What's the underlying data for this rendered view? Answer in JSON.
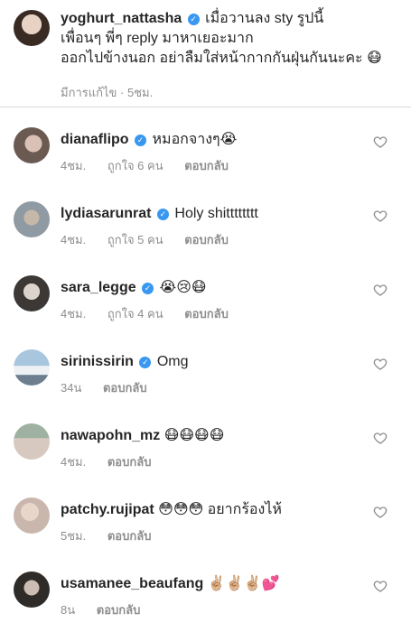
{
  "caption": {
    "username": "yoghurt_nattasha",
    "line1": "เมื่อวานลง sty รูปนี้",
    "line2": "เพื่อนๆ พี่ๆ reply มาหาเยอะมาก",
    "line3": "ออกไปข้างนอก อย่าลืมใส่หน้ากากกันฝุ่นกันนะคะ 😷",
    "edited": "มีการแก้ไข",
    "time": "5ชม."
  },
  "comments": [
    {
      "username": "dianaflipo",
      "verified": true,
      "text": "หมอกจางๆ😭",
      "time": "4ชม.",
      "likes": "ถูกใจ 6 คน",
      "reply": "ตอบกลับ"
    },
    {
      "username": "lydiasarunrat",
      "verified": true,
      "text": "Holy shitttttttt",
      "time": "4ชม.",
      "likes": "ถูกใจ 5 คน",
      "reply": "ตอบกลับ"
    },
    {
      "username": "sara_legge",
      "verified": true,
      "text": "😭😢😷",
      "time": "4ชม.",
      "likes": "ถูกใจ 4 คน",
      "reply": "ตอบกลับ"
    },
    {
      "username": "sirinissirin",
      "verified": true,
      "text": "Omg",
      "time": "34น",
      "likes": "",
      "reply": "ตอบกลับ"
    },
    {
      "username": "nawapohn_mz",
      "verified": false,
      "text": "😷😷😷😷",
      "time": "4ชม.",
      "likes": "",
      "reply": "ตอบกลับ"
    },
    {
      "username": "patchy.rujipat",
      "verified": false,
      "text": "😳😳😳 อยากร้องไห้",
      "time": "5ชม.",
      "likes": "",
      "reply": "ตอบกลับ"
    },
    {
      "username": "usamanee_beaufang",
      "verified": false,
      "text": "✌🏼✌🏼✌🏼💕",
      "time": "8น",
      "likes": "",
      "reply": "ตอบกลับ"
    }
  ],
  "icons": {
    "verified": "verified-badge-icon",
    "like": "heart-outline-icon"
  },
  "colors": {
    "verified": "#3897f0",
    "meta": "#8e8e8e",
    "text": "#262626"
  }
}
